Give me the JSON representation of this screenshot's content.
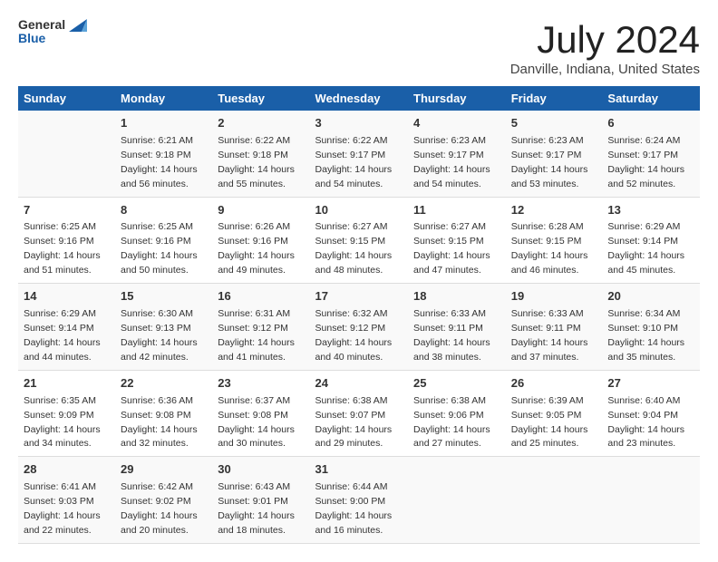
{
  "logo": {
    "general": "General",
    "blue": "Blue"
  },
  "title": "July 2024",
  "location": "Danville, Indiana, United States",
  "days_header": [
    "Sunday",
    "Monday",
    "Tuesday",
    "Wednesday",
    "Thursday",
    "Friday",
    "Saturday"
  ],
  "weeks": [
    [
      {
        "num": "",
        "sunrise": "",
        "sunset": "",
        "daylight": ""
      },
      {
        "num": "1",
        "sunrise": "Sunrise: 6:21 AM",
        "sunset": "Sunset: 9:18 PM",
        "daylight": "Daylight: 14 hours and 56 minutes."
      },
      {
        "num": "2",
        "sunrise": "Sunrise: 6:22 AM",
        "sunset": "Sunset: 9:18 PM",
        "daylight": "Daylight: 14 hours and 55 minutes."
      },
      {
        "num": "3",
        "sunrise": "Sunrise: 6:22 AM",
        "sunset": "Sunset: 9:17 PM",
        "daylight": "Daylight: 14 hours and 54 minutes."
      },
      {
        "num": "4",
        "sunrise": "Sunrise: 6:23 AM",
        "sunset": "Sunset: 9:17 PM",
        "daylight": "Daylight: 14 hours and 54 minutes."
      },
      {
        "num": "5",
        "sunrise": "Sunrise: 6:23 AM",
        "sunset": "Sunset: 9:17 PM",
        "daylight": "Daylight: 14 hours and 53 minutes."
      },
      {
        "num": "6",
        "sunrise": "Sunrise: 6:24 AM",
        "sunset": "Sunset: 9:17 PM",
        "daylight": "Daylight: 14 hours and 52 minutes."
      }
    ],
    [
      {
        "num": "7",
        "sunrise": "Sunrise: 6:25 AM",
        "sunset": "Sunset: 9:16 PM",
        "daylight": "Daylight: 14 hours and 51 minutes."
      },
      {
        "num": "8",
        "sunrise": "Sunrise: 6:25 AM",
        "sunset": "Sunset: 9:16 PM",
        "daylight": "Daylight: 14 hours and 50 minutes."
      },
      {
        "num": "9",
        "sunrise": "Sunrise: 6:26 AM",
        "sunset": "Sunset: 9:16 PM",
        "daylight": "Daylight: 14 hours and 49 minutes."
      },
      {
        "num": "10",
        "sunrise": "Sunrise: 6:27 AM",
        "sunset": "Sunset: 9:15 PM",
        "daylight": "Daylight: 14 hours and 48 minutes."
      },
      {
        "num": "11",
        "sunrise": "Sunrise: 6:27 AM",
        "sunset": "Sunset: 9:15 PM",
        "daylight": "Daylight: 14 hours and 47 minutes."
      },
      {
        "num": "12",
        "sunrise": "Sunrise: 6:28 AM",
        "sunset": "Sunset: 9:15 PM",
        "daylight": "Daylight: 14 hours and 46 minutes."
      },
      {
        "num": "13",
        "sunrise": "Sunrise: 6:29 AM",
        "sunset": "Sunset: 9:14 PM",
        "daylight": "Daylight: 14 hours and 45 minutes."
      }
    ],
    [
      {
        "num": "14",
        "sunrise": "Sunrise: 6:29 AM",
        "sunset": "Sunset: 9:14 PM",
        "daylight": "Daylight: 14 hours and 44 minutes."
      },
      {
        "num": "15",
        "sunrise": "Sunrise: 6:30 AM",
        "sunset": "Sunset: 9:13 PM",
        "daylight": "Daylight: 14 hours and 42 minutes."
      },
      {
        "num": "16",
        "sunrise": "Sunrise: 6:31 AM",
        "sunset": "Sunset: 9:12 PM",
        "daylight": "Daylight: 14 hours and 41 minutes."
      },
      {
        "num": "17",
        "sunrise": "Sunrise: 6:32 AM",
        "sunset": "Sunset: 9:12 PM",
        "daylight": "Daylight: 14 hours and 40 minutes."
      },
      {
        "num": "18",
        "sunrise": "Sunrise: 6:33 AM",
        "sunset": "Sunset: 9:11 PM",
        "daylight": "Daylight: 14 hours and 38 minutes."
      },
      {
        "num": "19",
        "sunrise": "Sunrise: 6:33 AM",
        "sunset": "Sunset: 9:11 PM",
        "daylight": "Daylight: 14 hours and 37 minutes."
      },
      {
        "num": "20",
        "sunrise": "Sunrise: 6:34 AM",
        "sunset": "Sunset: 9:10 PM",
        "daylight": "Daylight: 14 hours and 35 minutes."
      }
    ],
    [
      {
        "num": "21",
        "sunrise": "Sunrise: 6:35 AM",
        "sunset": "Sunset: 9:09 PM",
        "daylight": "Daylight: 14 hours and 34 minutes."
      },
      {
        "num": "22",
        "sunrise": "Sunrise: 6:36 AM",
        "sunset": "Sunset: 9:08 PM",
        "daylight": "Daylight: 14 hours and 32 minutes."
      },
      {
        "num": "23",
        "sunrise": "Sunrise: 6:37 AM",
        "sunset": "Sunset: 9:08 PM",
        "daylight": "Daylight: 14 hours and 30 minutes."
      },
      {
        "num": "24",
        "sunrise": "Sunrise: 6:38 AM",
        "sunset": "Sunset: 9:07 PM",
        "daylight": "Daylight: 14 hours and 29 minutes."
      },
      {
        "num": "25",
        "sunrise": "Sunrise: 6:38 AM",
        "sunset": "Sunset: 9:06 PM",
        "daylight": "Daylight: 14 hours and 27 minutes."
      },
      {
        "num": "26",
        "sunrise": "Sunrise: 6:39 AM",
        "sunset": "Sunset: 9:05 PM",
        "daylight": "Daylight: 14 hours and 25 minutes."
      },
      {
        "num": "27",
        "sunrise": "Sunrise: 6:40 AM",
        "sunset": "Sunset: 9:04 PM",
        "daylight": "Daylight: 14 hours and 23 minutes."
      }
    ],
    [
      {
        "num": "28",
        "sunrise": "Sunrise: 6:41 AM",
        "sunset": "Sunset: 9:03 PM",
        "daylight": "Daylight: 14 hours and 22 minutes."
      },
      {
        "num": "29",
        "sunrise": "Sunrise: 6:42 AM",
        "sunset": "Sunset: 9:02 PM",
        "daylight": "Daylight: 14 hours and 20 minutes."
      },
      {
        "num": "30",
        "sunrise": "Sunrise: 6:43 AM",
        "sunset": "Sunset: 9:01 PM",
        "daylight": "Daylight: 14 hours and 18 minutes."
      },
      {
        "num": "31",
        "sunrise": "Sunrise: 6:44 AM",
        "sunset": "Sunset: 9:00 PM",
        "daylight": "Daylight: 14 hours and 16 minutes."
      },
      {
        "num": "",
        "sunrise": "",
        "sunset": "",
        "daylight": ""
      },
      {
        "num": "",
        "sunrise": "",
        "sunset": "",
        "daylight": ""
      },
      {
        "num": "",
        "sunrise": "",
        "sunset": "",
        "daylight": ""
      }
    ]
  ]
}
